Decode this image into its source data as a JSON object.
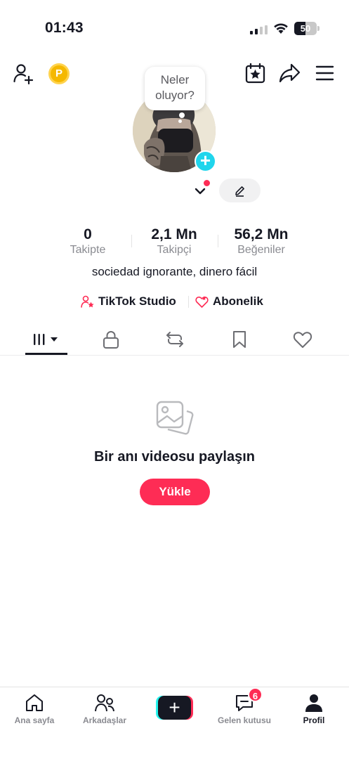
{
  "status_bar": {
    "time": "01:43",
    "battery_level": "50",
    "battery_fraction": 0.5
  },
  "header": {
    "icons": [
      "add-friend-icon",
      "coin-icon",
      "calendar-star-icon",
      "share-icon",
      "menu-icon"
    ],
    "coin_letter": "P"
  },
  "profile": {
    "note_line1": "Neler",
    "note_line2": "oluyor?",
    "stats": [
      {
        "value": "0",
        "label": "Takipte"
      },
      {
        "value": "2,1 Mn",
        "label": "Takipçi"
      },
      {
        "value": "56,2 Mn",
        "label": "Beğeniler"
      }
    ],
    "bio": "sociedad ignorante, dinero fácil",
    "links": [
      {
        "label": "TikTok Studio",
        "icon": "person-star-icon"
      },
      {
        "label": "Abonelik",
        "icon": "subscription-icon"
      }
    ]
  },
  "tabs": [
    "videos-tab",
    "private-tab",
    "reposts-tab",
    "favorites-tab",
    "liked-tab"
  ],
  "empty_state": {
    "title": "Bir anı videosu paylaşın",
    "button": "Yükle"
  },
  "bottom_nav": {
    "items": [
      {
        "label": "Ana sayfa"
      },
      {
        "label": "Arkadaşlar"
      },
      {
        "label": "Gelen kutusu"
      },
      {
        "label": "Profil"
      }
    ],
    "inbox_badge": "6"
  },
  "colors": {
    "accent": "#fe2c55",
    "cyan": "#25f4ee",
    "avatar_plus": "#20d5ec",
    "text": "#161823",
    "muted": "#8a8b91"
  }
}
